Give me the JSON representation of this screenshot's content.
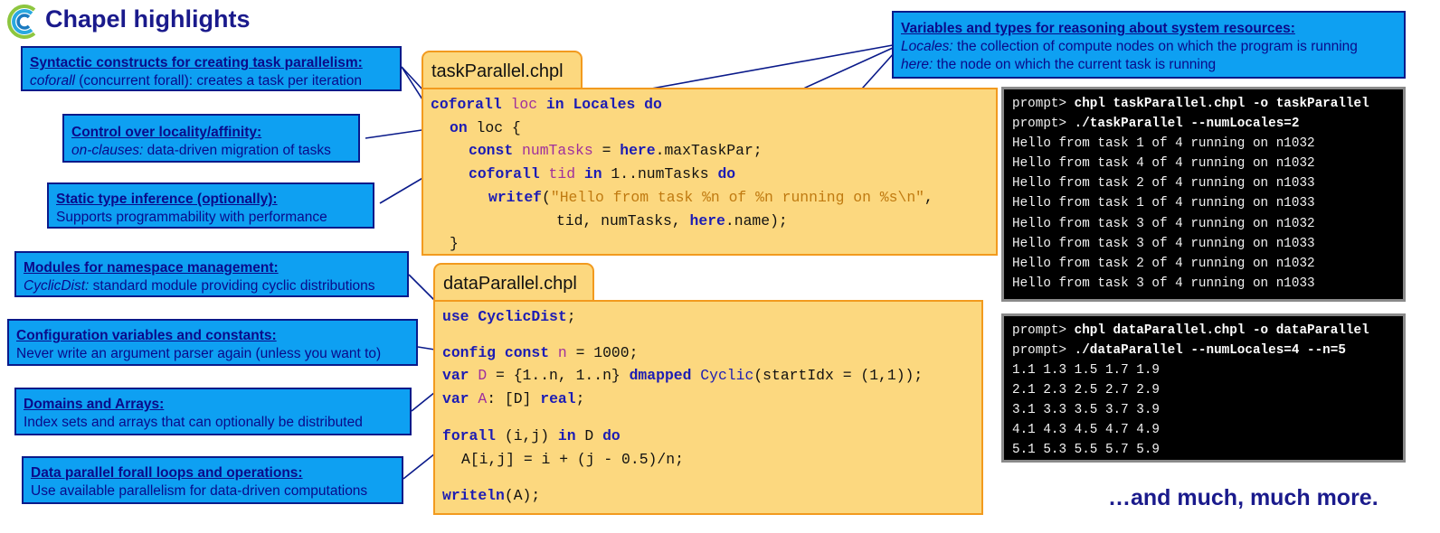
{
  "title": "Chapel highlights",
  "more_text": "…and much, much more.",
  "colors": {
    "callout_fill": "#0ea0f2",
    "callout_text": "#0a0a8a",
    "code_fill": "#fcd87f",
    "code_border": "#f29a1e",
    "title": "#1a1a8c"
  },
  "callouts": [
    {
      "heading": "Syntactic constructs for creating task parallelism:",
      "em": "coforall",
      "rest": " (concurrent forall): creates a task per iteration"
    },
    {
      "heading": "Control over locality/affinity:",
      "em": "on-clauses:",
      "rest": " data-driven migration of tasks"
    },
    {
      "heading": "Static type inference (optionally):",
      "em": "",
      "rest": "Supports programmability with performance"
    },
    {
      "heading": "Modules for namespace management:",
      "em": "CyclicDist:",
      "rest": " standard module providing cyclic distributions"
    },
    {
      "heading": "Configuration variables and constants:",
      "em": "",
      "rest": "Never write an argument parser again (unless you want to)"
    },
    {
      "heading": "Domains and Arrays:",
      "em": "",
      "rest": "Index sets and arrays  that can optionally be distributed"
    },
    {
      "heading": "Data parallel forall loops and operations:",
      "em": "",
      "rest": "Use available parallelism for data-driven computations"
    }
  ],
  "vars_callout": {
    "heading": "Variables and types for reasoning about system resources:",
    "line1_em": "Locales:",
    "line1_rest": " the collection of compute nodes on which the program is running",
    "line2_em": "here:",
    "line2_rest": " the node on which the current task is running"
  },
  "task_file": "taskParallel.chpl",
  "task_code": {
    "l1": [
      "coforall",
      "loc",
      "in",
      "Locales",
      "do"
    ],
    "l2": [
      "on",
      "loc {"
    ],
    "l3": [
      "const",
      "numTasks",
      " = ",
      "here",
      ".maxTaskPar;"
    ],
    "l4": [
      "coforall",
      "tid",
      "in",
      " 1..numTasks ",
      "do"
    ],
    "l5": [
      "writef",
      "(",
      "\"Hello from task %n of %n running on %s\\n\"",
      ","
    ],
    "l6": [
      "tid, numTasks, ",
      "here",
      ".name);"
    ],
    "l7": "}"
  },
  "data_file": "dataParallel.chpl",
  "data_code": {
    "l1": [
      "use",
      "CyclicDist",
      ";"
    ],
    "l2": [
      "config",
      "const",
      "n",
      " = 1000;"
    ],
    "l3": [
      "var",
      "D",
      " = {1..n, 1..n} ",
      "dmapped",
      "Cyclic",
      "(startIdx = (1,1));"
    ],
    "l4": [
      "var",
      "A",
      ": [D] ",
      "real",
      ";"
    ],
    "l5": [
      "forall",
      " (i,j) ",
      "in",
      " D ",
      "do"
    ],
    "l6": "A[i,j] = i + (j - 0.5)/n;",
    "l7": [
      "writeln",
      "(A);"
    ]
  },
  "terminal1": {
    "prompt1": "prompt> ",
    "cmd1": "chpl taskParallel.chpl -o taskParallel",
    "prompt2": "prompt> ",
    "cmd2": "./taskParallel --numLocales=2",
    "output": [
      "Hello from task 1 of 4 running on n1032",
      "Hello from task 4 of 4 running on n1032",
      "Hello from task 2 of 4 running on n1033",
      "Hello from task 1 of 4 running on n1033",
      "Hello from task 3 of 4 running on n1032",
      "Hello from task 3 of 4 running on n1033",
      "Hello from task 2 of 4 running on n1032",
      "Hello from task 3 of 4 running on n1033"
    ]
  },
  "terminal2": {
    "prompt1": "prompt> ",
    "cmd1": "chpl dataParallel.chpl -o dataParallel",
    "prompt2": "prompt> ",
    "cmd2": "./dataParallel --numLocales=4 --n=5",
    "output": [
      "1.1 1.3 1.5 1.7 1.9",
      "2.1 2.3 2.5 2.7 2.9",
      "3.1 3.3 3.5 3.7 3.9",
      "4.1 4.3 4.5 4.7 4.9",
      "5.1 5.3 5.5 5.7 5.9"
    ]
  }
}
